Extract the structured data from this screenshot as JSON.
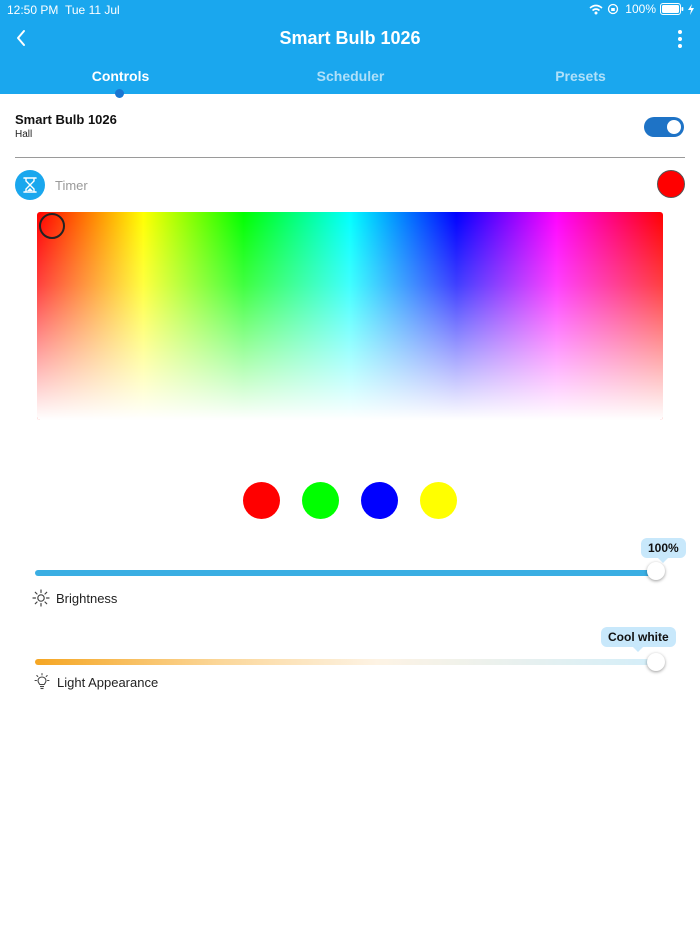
{
  "status_bar": {
    "time": "12:50 PM",
    "date": "Tue 11 Jul",
    "battery": "100%"
  },
  "header": {
    "title": "Smart Bulb 1026",
    "back_icon": "chevron-left-icon",
    "menu_icon": "more-vertical-icon"
  },
  "tabs": [
    {
      "label": "Controls",
      "active": true
    },
    {
      "label": "Scheduler",
      "active": false
    },
    {
      "label": "Presets",
      "active": false
    }
  ],
  "device": {
    "name": "Smart Bulb 1026",
    "room": "Hall",
    "power_on": true
  },
  "timer": {
    "label": "Timer",
    "icon": "hourglass-icon"
  },
  "color": {
    "current": "#ff0000",
    "presets": [
      "#ff0000",
      "#00ff00",
      "#0000ff",
      "#ffff00"
    ]
  },
  "brightness": {
    "label": "Brightness",
    "value_label": "100%",
    "value": 100,
    "icon": "sun-icon"
  },
  "appearance": {
    "label": "Light Appearance",
    "value_label": "Cool white",
    "icon": "bulb-icon"
  },
  "colors": {
    "header": "#1aa7ee",
    "toggle": "#1e73c6",
    "brightness_track": "#3aaee3"
  }
}
